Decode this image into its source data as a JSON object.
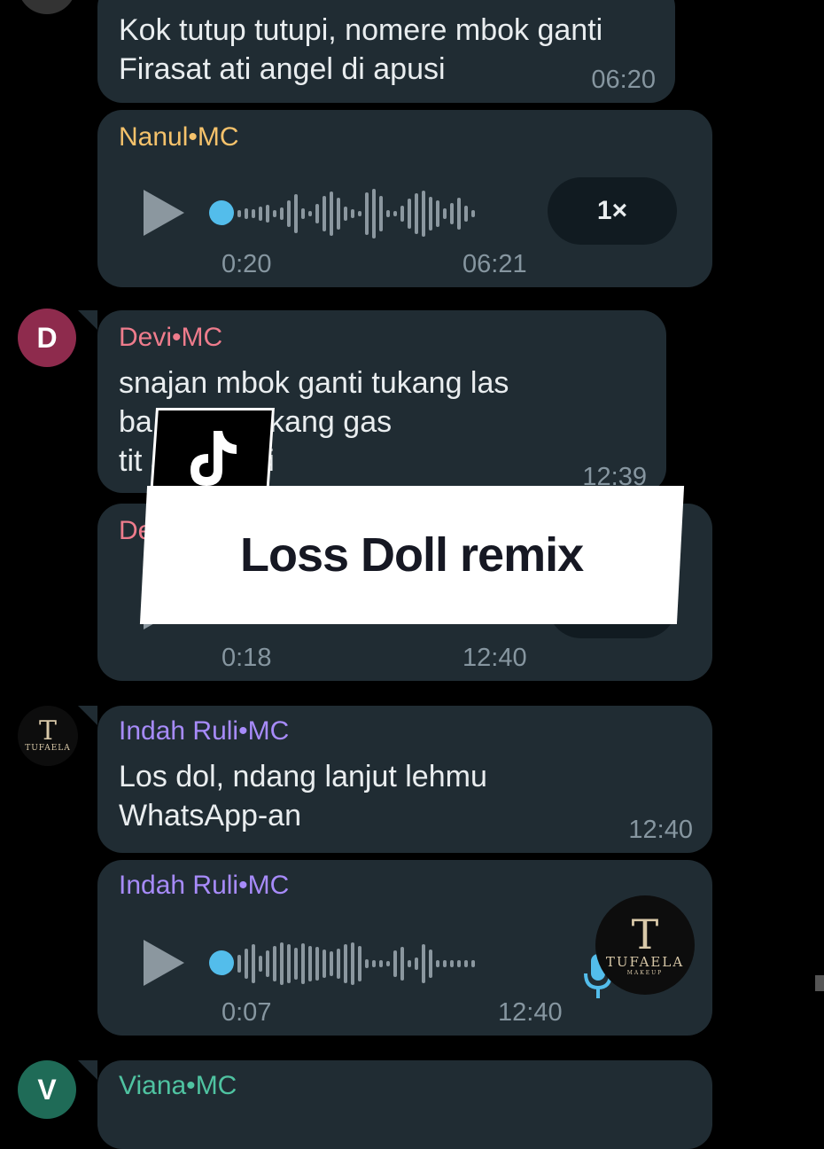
{
  "messages": {
    "m1": {
      "text": "Kok tutup tutupi, nomere mbok ganti\nFirasat ati angel di apusi",
      "time": "06:20"
    },
    "m2": {
      "sender": "Nanul•MC",
      "elapsed": "0:20",
      "time": "06:21",
      "speed": "1×"
    },
    "m3": {
      "avatar_letter": "D",
      "sender": "Devi•MC",
      "text": "snajan mbok ganti tukang las\nba        ur lan tukang gas\ntit           ale ngerti",
      "time": "12:39"
    },
    "m4": {
      "sender": "Dev",
      "elapsed": "0:18",
      "time": "12:40"
    },
    "m5": {
      "sender": "Indah Ruli•MC",
      "text": "Los dol, ndang lanjut lehmu\nWhatsApp-an",
      "time": "12:40"
    },
    "m6": {
      "sender": "Indah Ruli•MC",
      "elapsed": "0:07",
      "time": "12:40"
    },
    "m7": {
      "avatar_letter": "V",
      "sender": "Viana•MC"
    }
  },
  "overlay": {
    "title": "Loss Doll remix"
  },
  "logos": {
    "tufaela": "TUFAELA",
    "tufaela_sub": "MAKEUP",
    "tufaela_mark": "T"
  },
  "colors": {
    "bubble": "#202c33",
    "sender_nanul": "#f5c26b",
    "sender_devi": "#ee7c8c",
    "sender_indah": "#a78bfa",
    "sender_viana": "#4fc3a1",
    "avatar_devi": "#8e2b4d",
    "avatar_viana": "#1f6b57",
    "accent_dot": "#53bdeb"
  },
  "icons": [
    "play-icon",
    "tiktok-icon",
    "microphone-icon"
  ]
}
